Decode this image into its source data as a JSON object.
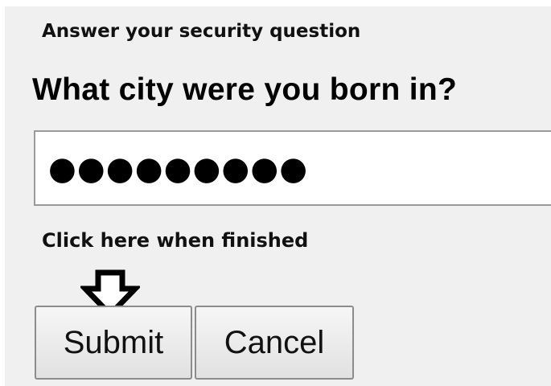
{
  "dialog": {
    "title": "Answer your security question",
    "question": "What city were you born in?",
    "answer_value": "●●●●●●●●●",
    "instruction": "Click here when finished",
    "arrow_icon": "arrow-down-outline-icon"
  },
  "buttons": {
    "submit_label": "Submit",
    "cancel_label": "Cancel"
  },
  "colors": {
    "background": "#f0f0f0",
    "field_border": "#9a9a9a",
    "button_border": "#8c8c8c",
    "text": "#000000"
  }
}
